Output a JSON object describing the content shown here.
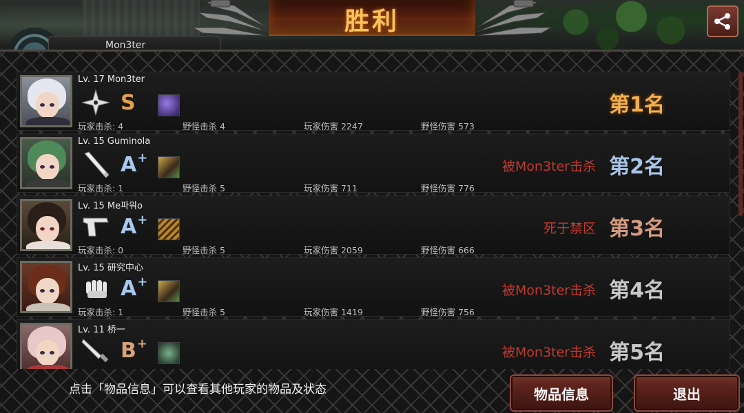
{
  "header": {
    "title": "胜利",
    "player_tag": "Mon3ter",
    "share_icon": "share-icon"
  },
  "players": [
    {
      "level_name": "Lv. 17 Mon3ter",
      "weapon": "shuriken-icon",
      "grade": "S",
      "grade_plus": "",
      "grade_color": "#e0a04a",
      "player_kills": "玩家击杀: 4",
      "monster_kills": "野怪击杀 4",
      "player_damage": "玩家伤害 2247",
      "monster_damage": "野怪伤害 573",
      "death": "",
      "rank": "第1名",
      "rank_color": "#f0b050"
    },
    {
      "level_name": "Lv. 15 Guminola",
      "weapon": "bat-icon",
      "grade": "A",
      "grade_plus": "+",
      "grade_color": "#a9c8ec",
      "player_kills": "玩家击杀: 1",
      "monster_kills": "野怪击杀 5",
      "player_damage": "玩家伤害 711",
      "monster_damage": "野怪伤害 776",
      "death": "被Mon3ter击杀",
      "rank": "第2名",
      "rank_color": "#a9c4e6"
    },
    {
      "level_name": "Lv. 15 Me파워o",
      "weapon": "pistol-icon",
      "grade": "A",
      "grade_plus": "+",
      "grade_color": "#a9c8ec",
      "player_kills": "玩家击杀: 0",
      "monster_kills": "野怪击杀 5",
      "player_damage": "玩家伤害 2059",
      "monster_damage": "野怪伤害 666",
      "death": "死于禁区",
      "rank": "第3名",
      "rank_color": "#d49a80"
    },
    {
      "level_name": "Lv. 15 研究中心",
      "weapon": "fist-icon",
      "grade": "A",
      "grade_plus": "+",
      "grade_color": "#a9c8ec",
      "player_kills": "玩家击杀: 1",
      "monster_kills": "野怪击杀 5",
      "player_damage": "玩家伤害 1419",
      "monster_damage": "野怪伤害 756",
      "death": "被Mon3ter击杀",
      "rank": "第4名",
      "rank_color": "#c8c8c8"
    },
    {
      "level_name": "Lv. 11 桥一",
      "weapon": "knife-icon",
      "grade": "B",
      "grade_plus": "+",
      "grade_color": "#d6a37a",
      "player_kills": "",
      "monster_kills": "",
      "player_damage": "",
      "monster_damage": "",
      "death": "被Mon3ter击杀",
      "rank": "第5名",
      "rank_color": "#c8c8c8"
    }
  ],
  "footer": {
    "hint": "点击「物品信息」可以查看其他玩家的物品及状态",
    "items_button": "物品信息",
    "exit_button": "退出"
  }
}
